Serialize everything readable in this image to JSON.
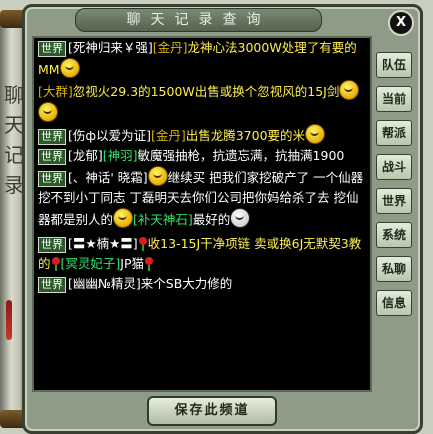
{
  "window": {
    "title": "聊天记录查询",
    "close_label": "X"
  },
  "scroll_decoration": {
    "text": "聊天记录"
  },
  "side_tabs": [
    "队伍",
    "当前",
    "帮派",
    "战斗",
    "世界",
    "系统",
    "私聊",
    "信息"
  ],
  "save_button": "保存此频道",
  "messages": [
    {
      "channel": "世界",
      "sender": "[死神归来￥强]",
      "target": "[金丹]",
      "text": "龙神心法3000W处理了有要的MM"
    },
    {
      "channel": "",
      "sender": "",
      "target": "[大群]",
      "text": "忽视火29.3的1500W出售或换个忽视风的15J剑"
    },
    {
      "channel": "世界",
      "sender": "[伤ф以爱为证]",
      "target": "[金丹]",
      "text": "出售龙腾3700要的米"
    },
    {
      "channel": "世界",
      "sender": "[龙郁]",
      "target": "[神羽]",
      "text": "敏魔强抽枪，抗遗忘满，抗抽满1900"
    },
    {
      "channel": "世界",
      "sender": "[、神话' 晓霜]",
      "target": "",
      "text": "继续买 把我们家挖破产了 一个仙器挖不到小丁同志 丁磊明天去你们公司把你妈给杀了去 挖仙器都是别人的"
    },
    {
      "channel": "",
      "sender": "",
      "target": "[补天神石]",
      "text": "最好的"
    },
    {
      "channel": "世界",
      "sender": "[〓★楠★〓]",
      "target": "",
      "text": "收13-15J干净项链 卖或换6J无默契3教的"
    },
    {
      "channel": "",
      "sender": "",
      "target": "[冥灵妃子]",
      "text": "JP猫"
    },
    {
      "channel": "世界",
      "sender": "[幽幽№精灵]",
      "target": "",
      "text": "来个SB大力修的"
    }
  ]
}
